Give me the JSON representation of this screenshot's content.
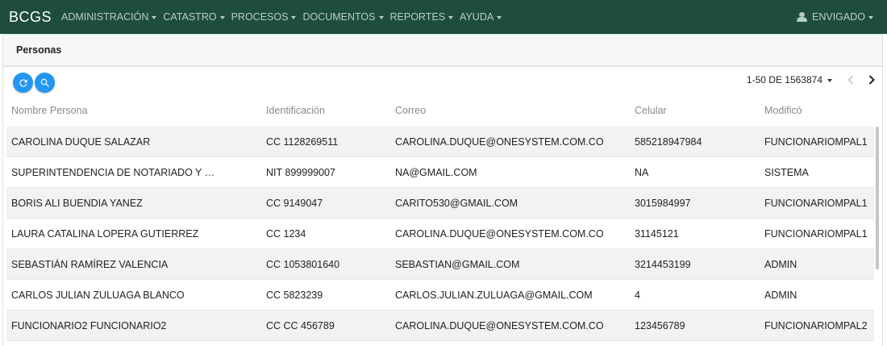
{
  "navbar": {
    "brand": "BCGS",
    "menu": [
      {
        "label": "ADMINISTRACIÓN"
      },
      {
        "label": "CATASTRO"
      },
      {
        "label": "PROCESOS"
      },
      {
        "label": "DOCUMENTOS"
      },
      {
        "label": "REPORTES"
      },
      {
        "label": "AYUDA"
      }
    ],
    "user": "ENVIGADO"
  },
  "panel": {
    "title": "Personas"
  },
  "toolbar": {
    "refresh_icon": "refresh-icon",
    "search_icon": "search-icon"
  },
  "pager": {
    "label": "1-50 DE 1563874"
  },
  "table": {
    "headers": [
      "Nombre Persona",
      "Identificación",
      "Correo",
      "Celular",
      "Modificó"
    ],
    "rows": [
      [
        "CAROLINA DUQUE SALAZAR",
        "CC 1128269511",
        "CAROLINA.DUQUE@ONESYSTEM.COM.CO",
        "585218947984",
        "FUNCIONARIOMPAL1"
      ],
      [
        "SUPERINTENDENCIA DE NOTARIADO Y …",
        "NIT 899999007",
        "NA@GMAIL.COM",
        "NA",
        "SISTEMA"
      ],
      [
        "BORIS ALI BUENDIA YANEZ",
        "CC 9149047",
        "CARITO530@GMAIL.COM",
        "3015984997",
        "FUNCIONARIOMPAL1"
      ],
      [
        "LAURA CATALINA LOPERA GUTIERREZ",
        "CC 1234",
        "CAROLINA.DUQUE@ONESYSTEM.COM.CO",
        "31145121",
        "FUNCIONARIOMPAL1"
      ],
      [
        "SEBASTIÁN RAMÍREZ VALENCIA",
        "CC 1053801640",
        "SEBASTIAN@GMAIL.COM",
        "3214453199",
        "ADMIN"
      ],
      [
        "CARLOS JULIAN ZULUAGA BLANCO",
        "CC 5823239",
        "CARLOS.JULIAN.ZULUAGA@GMAIL.COM",
        "4",
        "ADMIN"
      ],
      [
        "FUNCIONARIO2 FUNCIONARIO2",
        "CC CC 456789",
        "CAROLINA.DUQUE@ONESYSTEM.COM.CO",
        "123456789",
        "FUNCIONARIOMPAL2"
      ]
    ]
  },
  "colors": {
    "navbar": "#1e4d3e",
    "accent": "#2196f3"
  }
}
